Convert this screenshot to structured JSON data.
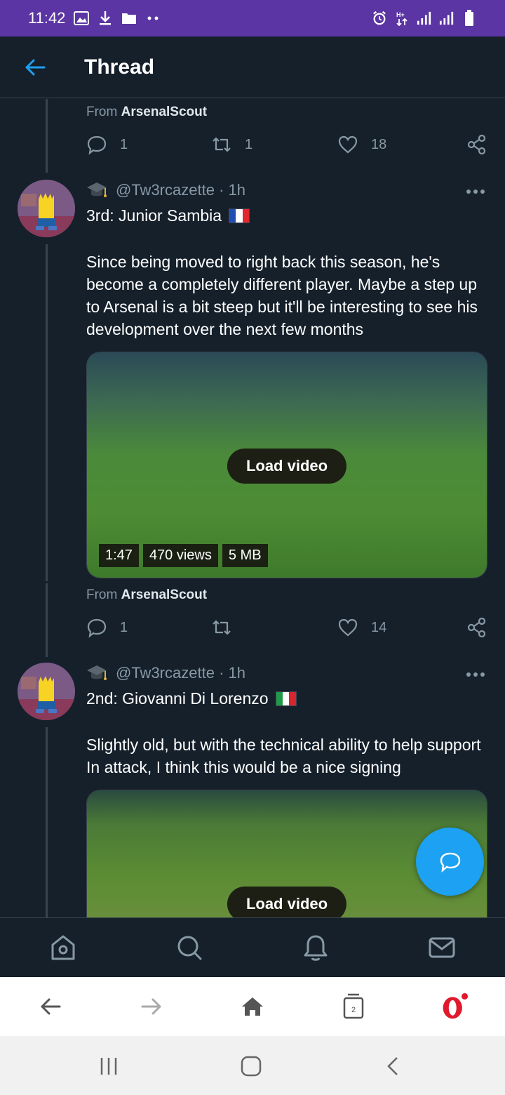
{
  "status_bar": {
    "time": "11:42"
  },
  "header": {
    "title": "Thread"
  },
  "prev_tweet": {
    "from_prefix": "From",
    "from_name": "ArsenalScout",
    "replies": "1",
    "retweets": "1",
    "likes": "18"
  },
  "tweets": [
    {
      "handle": "@Tw3rcazette",
      "time": "· 1h",
      "title": "3rd: Junior Sambia",
      "flag": "france",
      "body": "Since being moved to right back this season, he's become a completely different player. Maybe a step up to Arsenal is a bit steep but it'll be interesting to see his development over the next few months",
      "video": {
        "load_label": "Load video",
        "duration": "1:47",
        "views": "470 views",
        "size": "5 MB"
      },
      "from_prefix": "From",
      "from_name": "ArsenalScout",
      "replies": "1",
      "retweets": "",
      "likes": "14"
    },
    {
      "handle": "@Tw3rcazette",
      "time": "· 1h",
      "title": "2nd: Giovanni Di Lorenzo",
      "flag": "italy",
      "body": "Slightly old, but with the technical ability to help support In attack, I think this would be a nice signing",
      "video": {
        "load_label": "Load video"
      }
    }
  ],
  "browser": {
    "tab_count": "2"
  },
  "colors": {
    "accent": "#1da1f2",
    "background": "#15202b",
    "status_bar": "#5a35a3",
    "muted": "#8899a6"
  }
}
